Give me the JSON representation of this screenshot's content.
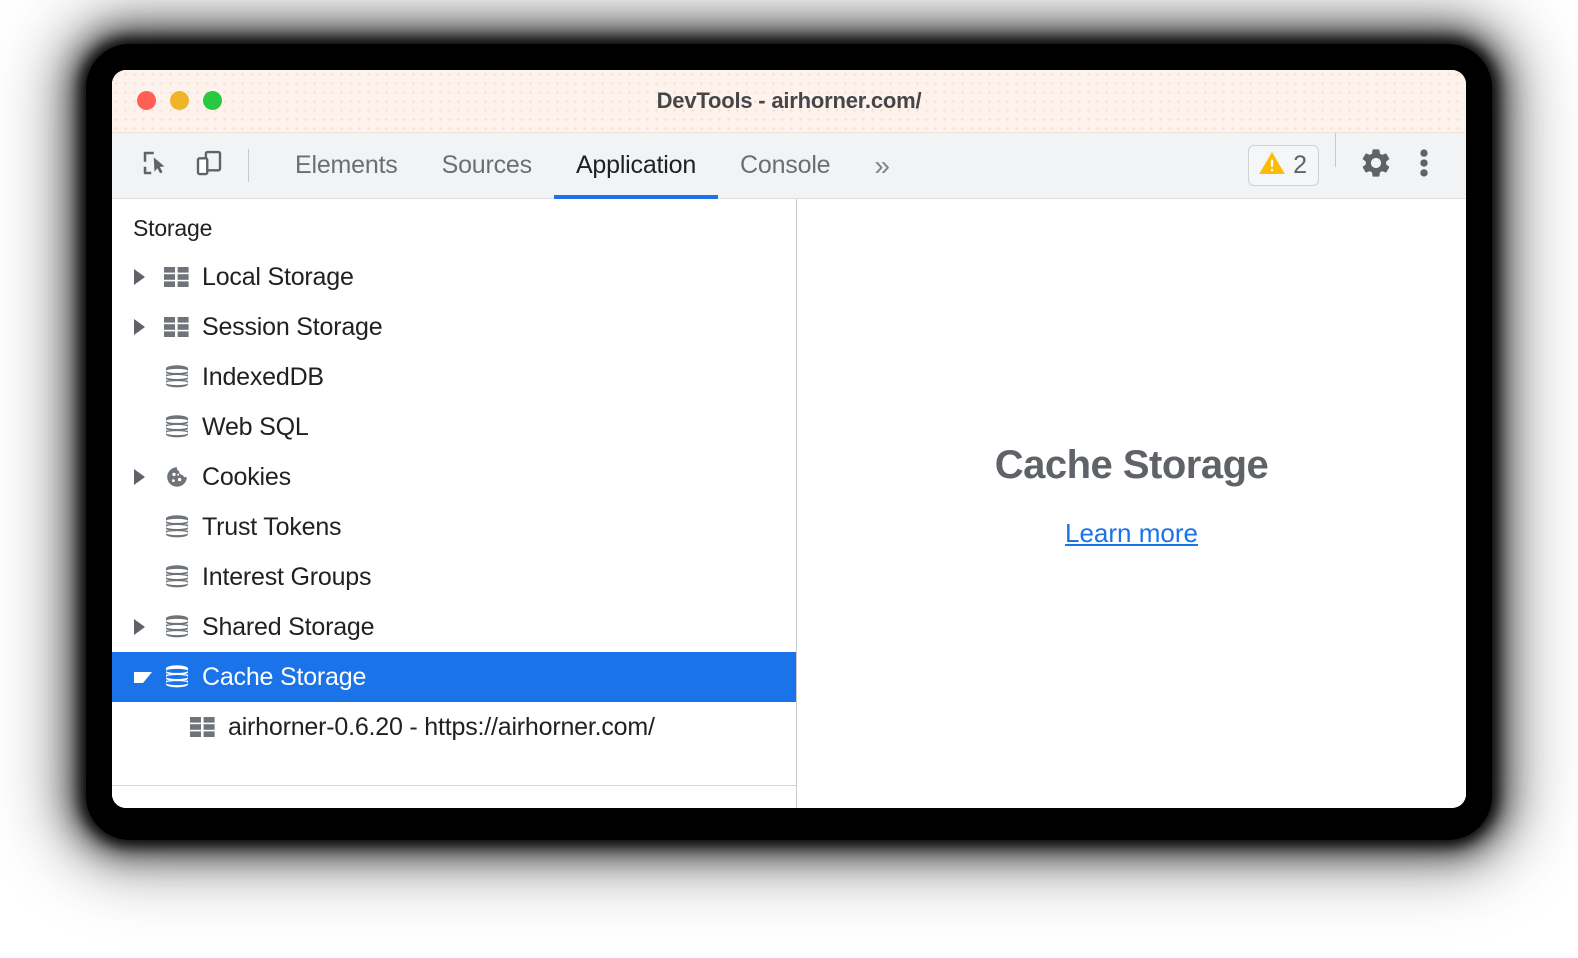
{
  "window": {
    "title": "DevTools - airhorner.com/",
    "controls": [
      {
        "name": "close",
        "color": "#ff5f56"
      },
      {
        "name": "minimize",
        "color": "#f0b429"
      },
      {
        "name": "maximize",
        "color": "#28c840"
      }
    ]
  },
  "toolbar": {
    "inspect_icon": "inspect-element-icon",
    "device_icon": "device-toolbar-icon",
    "tabs": [
      {
        "label": "Elements",
        "active": false
      },
      {
        "label": "Sources",
        "active": false
      },
      {
        "label": "Application",
        "active": true
      },
      {
        "label": "Console",
        "active": false
      }
    ],
    "more_tabs_label": "»",
    "warning_badge": {
      "icon": "warning-triangle-icon",
      "count": "2",
      "color": "#fbbc04"
    },
    "settings_icon": "gear-icon",
    "menu_icon": "kebab-menu-icon"
  },
  "sidebar": {
    "section_title": "Storage",
    "items": [
      {
        "label": "Local Storage",
        "icon": "table-icon",
        "twisty": "collapsed",
        "selected": false,
        "child": false
      },
      {
        "label": "Session Storage",
        "icon": "table-icon",
        "twisty": "collapsed",
        "selected": false,
        "child": false
      },
      {
        "label": "IndexedDB",
        "icon": "database-icon",
        "twisty": "none",
        "selected": false,
        "child": false
      },
      {
        "label": "Web SQL",
        "icon": "database-icon",
        "twisty": "none",
        "selected": false,
        "child": false
      },
      {
        "label": "Cookies",
        "icon": "cookie-icon",
        "twisty": "collapsed",
        "selected": false,
        "child": false
      },
      {
        "label": "Trust Tokens",
        "icon": "database-icon",
        "twisty": "none",
        "selected": false,
        "child": false
      },
      {
        "label": "Interest Groups",
        "icon": "database-icon",
        "twisty": "none",
        "selected": false,
        "child": false
      },
      {
        "label": "Shared Storage",
        "icon": "database-icon",
        "twisty": "collapsed",
        "selected": false,
        "child": false
      },
      {
        "label": "Cache Storage",
        "icon": "database-icon",
        "twisty": "expanded",
        "selected": true,
        "child": false
      },
      {
        "label": "airhorner-0.6.20 - https://airhorner.com/",
        "icon": "table-icon",
        "twisty": "none",
        "selected": false,
        "child": true
      }
    ]
  },
  "main": {
    "empty_title": "Cache Storage",
    "learn_more": "Learn more"
  },
  "colors": {
    "accent": "#1a73e8",
    "titlebar": "#fdf2ec",
    "toolbar": "#f1f3f4",
    "warning": "#fbbc04",
    "icon_gray": "#5f6368"
  }
}
